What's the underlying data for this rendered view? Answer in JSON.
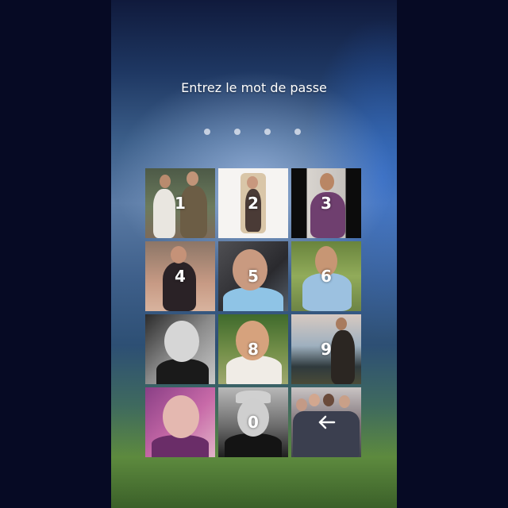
{
  "lockscreen": {
    "title": "Entrez le mot de passe",
    "pin_dots": 4
  },
  "keypad": {
    "keys": [
      {
        "label": "1",
        "photo": "photo-two-young-men"
      },
      {
        "label": "2",
        "photo": "photo-girl-standing"
      },
      {
        "label": "3",
        "photo": "photo-boy-sitting"
      },
      {
        "label": "4",
        "photo": "photo-girl-on-tiles"
      },
      {
        "label": "5",
        "photo": "photo-boy-selfie"
      },
      {
        "label": "6",
        "photo": "photo-girl-outdoors"
      },
      {
        "label": "",
        "photo": "photo-boy-black-white"
      },
      {
        "label": "8",
        "photo": "photo-girl-smiling"
      },
      {
        "label": "9",
        "photo": "photo-boy-seaside"
      },
      {
        "label": "",
        "photo": "photo-girl-purple"
      },
      {
        "label": "0",
        "photo": "photo-boy-cap"
      },
      {
        "label": "",
        "photo": "photo-group-friends",
        "icon": "backspace-arrow-icon"
      }
    ]
  },
  "colors": {
    "text": "#ffffff",
    "outer_background": "#060a24",
    "dot": "#e1e6f0"
  }
}
